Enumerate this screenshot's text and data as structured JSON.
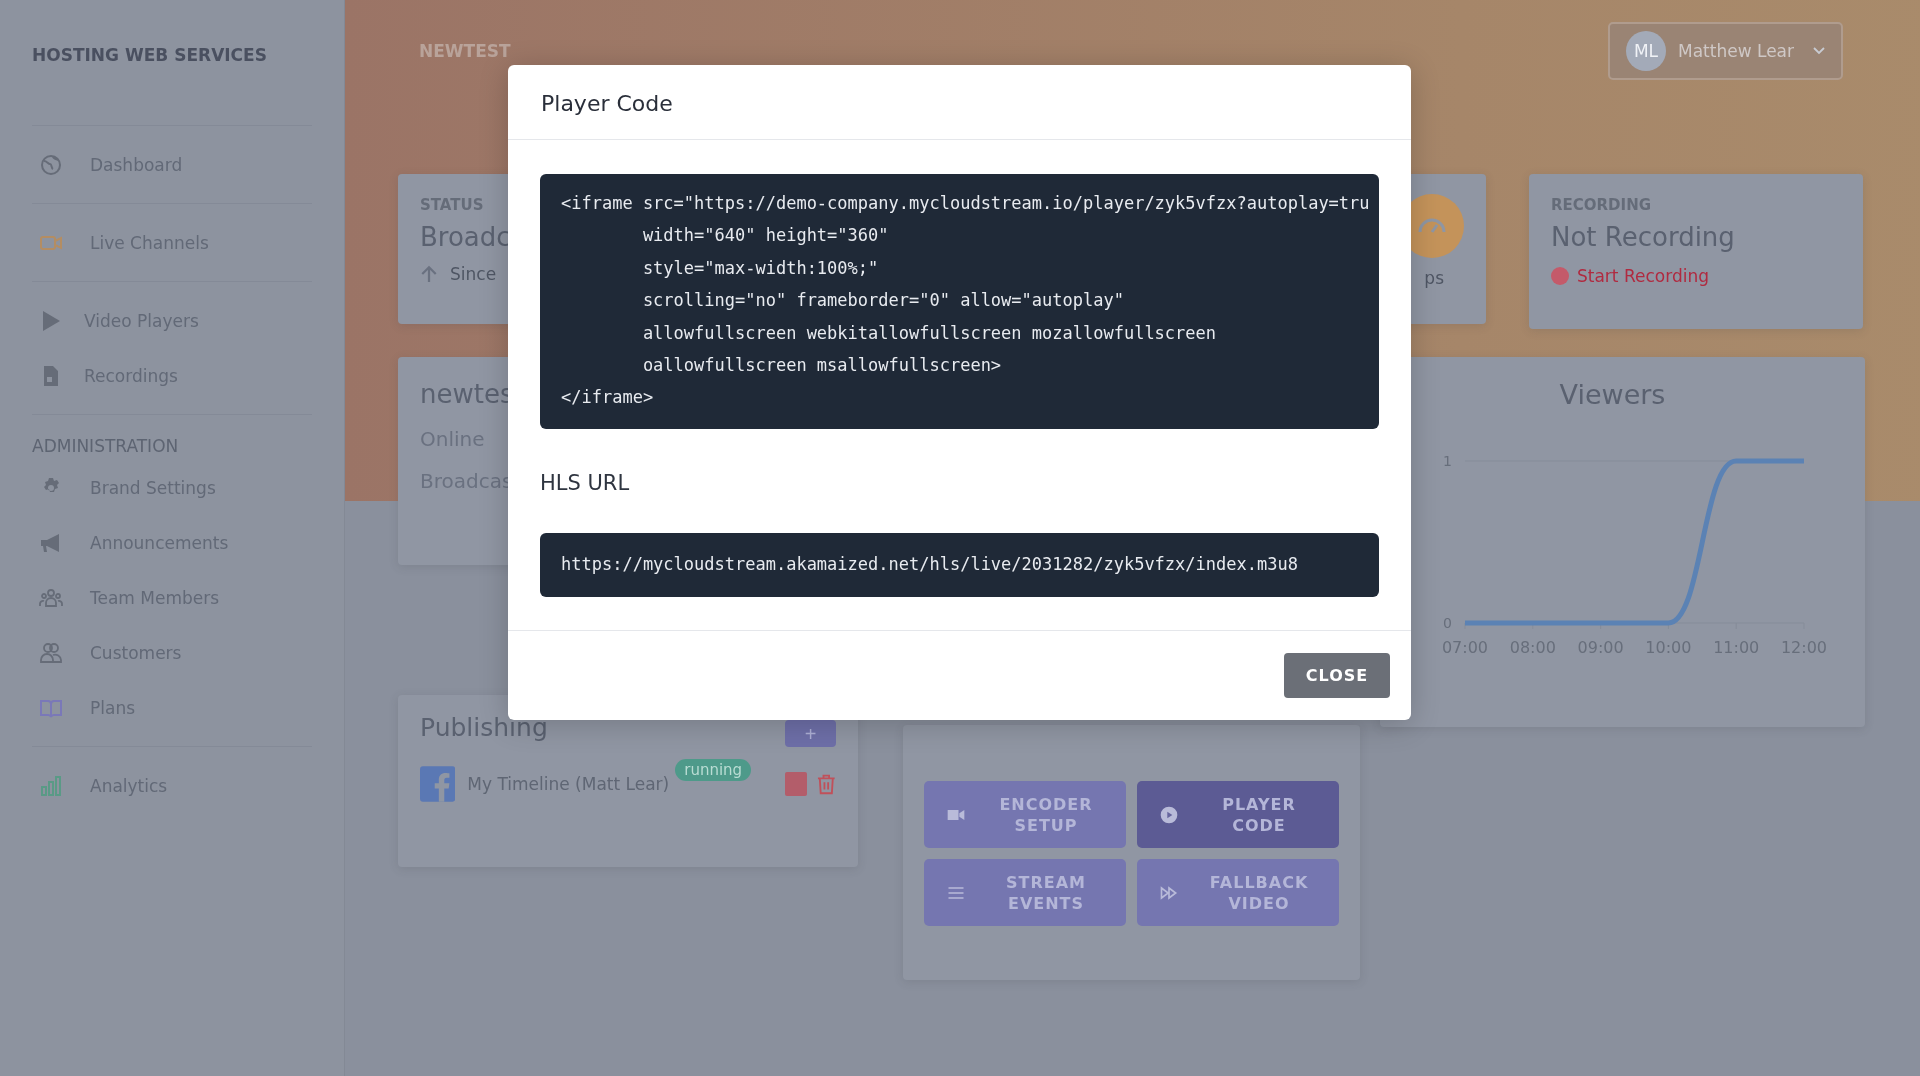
{
  "sidebar": {
    "brand": "HOSTING WEB SERVICES",
    "groups": [
      {
        "items": [
          {
            "label": "Dashboard"
          }
        ]
      },
      {
        "items": [
          {
            "label": "Live Channels"
          }
        ]
      },
      {
        "items": [
          {
            "label": "Video Players"
          },
          {
            "label": "Recordings"
          }
        ]
      },
      {
        "heading": "ADMINISTRATION",
        "items": [
          {
            "label": "Brand Settings"
          },
          {
            "label": "Announcements"
          },
          {
            "label": "Team Members"
          },
          {
            "label": "Customers"
          },
          {
            "label": "Plans"
          }
        ]
      },
      {
        "items": [
          {
            "label": "Analytics"
          }
        ]
      }
    ]
  },
  "topbar": {
    "title": "NEWTEST",
    "user": {
      "initials": "ML",
      "name": "Matthew Lear"
    }
  },
  "status_card": {
    "label": "STATUS",
    "value": "Broadc",
    "note": "Since"
  },
  "viewers_card": {
    "note": "ps"
  },
  "recording_card": {
    "label": "RECORDING",
    "value": "Not Recording",
    "action": "Start Recording"
  },
  "channel_card": {
    "title": "newtes",
    "lines": [
      "Online",
      "Broadcas"
    ]
  },
  "viewers_chart": {
    "chart_data": {
      "type": "line",
      "title": "Viewers",
      "categories": [
        "07:00",
        "08:00",
        "09:00",
        "10:00",
        "11:00",
        "12:00"
      ],
      "yticks": [
        0,
        1
      ],
      "ylim": [
        0,
        1
      ],
      "series": [
        {
          "color": "#5b82b4",
          "values": [
            0,
            0,
            0,
            0,
            1,
            1
          ]
        }
      ]
    }
  },
  "publishing": {
    "title": "Publishing",
    "add": "+",
    "destinations": [
      {
        "name": "My Timeline (Matt Lear)",
        "status": "running"
      }
    ]
  },
  "actions": [
    {
      "label": "ENCODER SETUP",
      "selected": false
    },
    {
      "label": "PLAYER CODE",
      "selected": true
    },
    {
      "label": "STREAM EVENTS",
      "selected": false
    },
    {
      "label": "FALLBACK VIDEO",
      "selected": false
    }
  ],
  "modal": {
    "title": "Player Code",
    "code": "<iframe src=\"https://demo-company.mycloudstream.io/player/zyk5vfzx?autoplay=tru\n        width=\"640\" height=\"360\"\n        style=\"max-width:100%;\"\n        scrolling=\"no\" frameborder=\"0\" allow=\"autoplay\"\n        allowfullscreen webkitallowfullscreen mozallowfullscreen\n        oallowfullscreen msallowfullscreen>\n</iframe>",
    "hls_label": "HLS URL",
    "hls_url": "https://mycloudstream.akamaized.net/hls/live/2031282/zyk5vfzx/index.m3u8",
    "close": "CLOSE"
  }
}
